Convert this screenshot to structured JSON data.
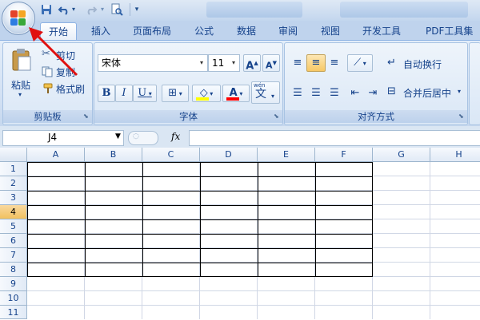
{
  "quick_access": {
    "save_icon": "save-icon",
    "undo_icon": "undo-icon",
    "redo_icon": "redo-icon",
    "print_preview_icon": "print-preview-icon",
    "customize_icon": "customize-qat-icon"
  },
  "tabs": [
    "开始",
    "插入",
    "页面布局",
    "公式",
    "数据",
    "审阅",
    "视图",
    "开发工具",
    "PDF工具集"
  ],
  "clipboard": {
    "paste_label": "粘贴",
    "cut_label": "剪切",
    "copy_label": "复制",
    "format_painter_label": "格式刷",
    "group_label": "剪贴板"
  },
  "font": {
    "font_name": "宋体",
    "font_size": "11",
    "grow_label": "A",
    "shrink_label": "A",
    "bold_label": "B",
    "italic_label": "I",
    "underline_label": "U",
    "phonetic_label": "wén",
    "phonetic_char": "文",
    "font_color_label": "A",
    "group_label": "字体"
  },
  "alignment": {
    "wrap_text_label": "自动换行",
    "merge_center_label": "合并后居中",
    "group_label": "对齐方式"
  },
  "formula_bar": {
    "name_box_value": "J4",
    "fx_label": "fx",
    "formula_value": ""
  },
  "sheet": {
    "columns": [
      "A",
      "B",
      "C",
      "D",
      "E",
      "F",
      "G",
      "H"
    ],
    "rows": [
      "1",
      "2",
      "3",
      "4",
      "5",
      "6",
      "7",
      "8",
      "9",
      "10",
      "11"
    ],
    "active_row": "4"
  },
  "colors": {
    "accent": "#15428b",
    "annotation_arrow": "#e01010",
    "fill_highlight": "#ffff00",
    "font_color": "#ff0000"
  }
}
